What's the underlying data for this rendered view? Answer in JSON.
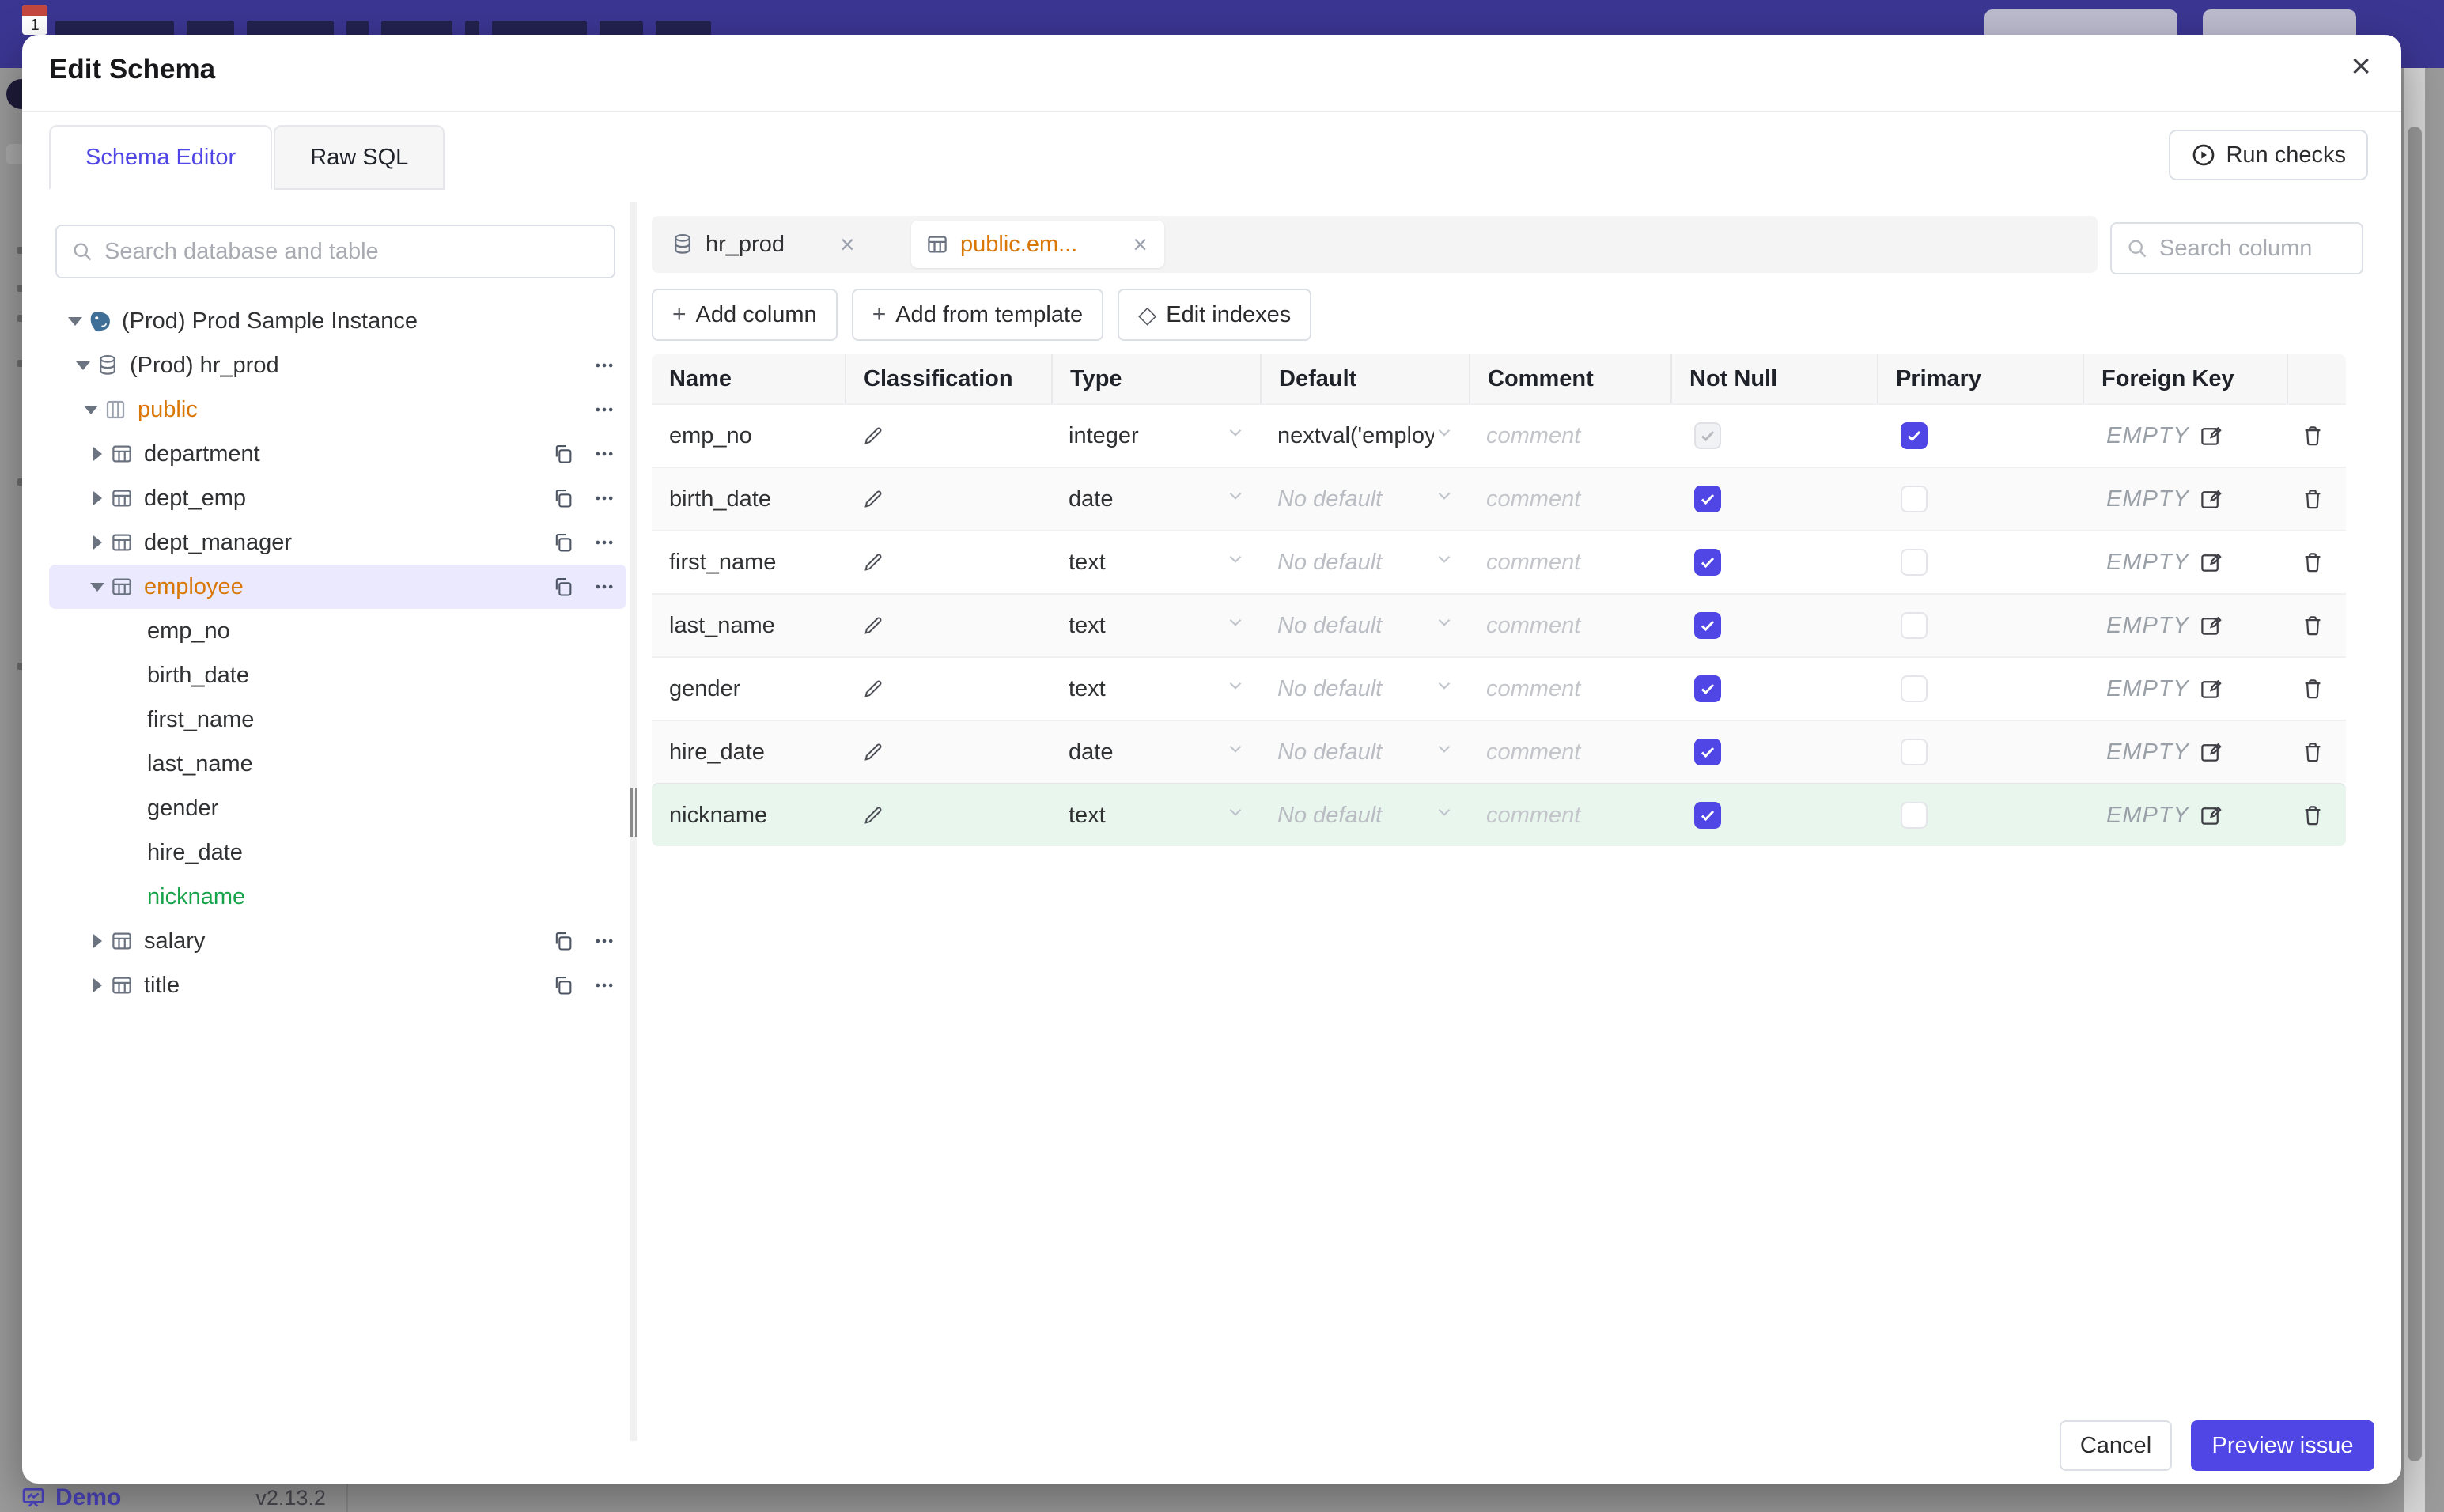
{
  "modal": {
    "title": "Edit Schema",
    "close_icon": "×"
  },
  "tabs": {
    "schema_editor": "Schema Editor",
    "raw_sql": "Raw SQL"
  },
  "run_checks_label": "Run checks",
  "sidebar": {
    "search_placeholder": "Search database and table",
    "tree": [
      {
        "label": "(Prod) Prod Sample Instance"
      },
      {
        "label": "(Prod) hr_prod"
      },
      {
        "label": "public"
      },
      {
        "label": "department"
      },
      {
        "label": "dept_emp"
      },
      {
        "label": "dept_manager"
      },
      {
        "label": "employee"
      },
      {
        "label": "emp_no"
      },
      {
        "label": "birth_date"
      },
      {
        "label": "first_name"
      },
      {
        "label": "last_name"
      },
      {
        "label": "gender"
      },
      {
        "label": "hire_date"
      },
      {
        "label": "nickname"
      },
      {
        "label": "salary"
      },
      {
        "label": "title"
      }
    ]
  },
  "editor": {
    "chips": [
      {
        "label": "hr_prod",
        "close": "×"
      },
      {
        "label": "public.em...",
        "close": "×"
      }
    ],
    "search_placeholder": "Search column",
    "actions": {
      "add_column": "Add column",
      "add_from_template": "Add from template",
      "edit_indexes": "Edit indexes",
      "plus_icon": "+",
      "diamond_icon": "◇"
    },
    "table": {
      "headers": [
        "Name",
        "Classification",
        "Type",
        "Default",
        "Comment",
        "Not Null",
        "Primary",
        "Foreign Key"
      ],
      "comment_placeholder": "comment",
      "empty_label": "EMPTY",
      "rows": [
        {
          "name": "emp_no",
          "type": "integer",
          "default": "nextval('employ",
          "not_null": "checked-disabled",
          "primary": "checked"
        },
        {
          "name": "birth_date",
          "type": "date",
          "default": "No default",
          "not_null": "checked",
          "primary": "unchecked"
        },
        {
          "name": "first_name",
          "type": "text",
          "default": "No default",
          "not_null": "checked",
          "primary": "unchecked"
        },
        {
          "name": "last_name",
          "type": "text",
          "default": "No default",
          "not_null": "checked",
          "primary": "unchecked"
        },
        {
          "name": "gender",
          "type": "text",
          "default": "No default",
          "not_null": "checked",
          "primary": "unchecked"
        },
        {
          "name": "hire_date",
          "type": "date",
          "default": "No default",
          "not_null": "checked",
          "primary": "unchecked"
        },
        {
          "name": "nickname",
          "type": "text",
          "default": "No default",
          "not_null": "checked",
          "primary": "unchecked"
        }
      ]
    }
  },
  "footer": {
    "cancel_label": "Cancel",
    "submit_label": "Preview issue"
  },
  "background": {
    "demo_label": "Demo",
    "version": "v2.13.2",
    "favicon_number": "1"
  },
  "colors": {
    "accent": "#4f46e5",
    "amber": "#d97706",
    "green": "#16a34a",
    "highlight_row": "#e9f6ee",
    "topbar": "#3b3692"
  }
}
